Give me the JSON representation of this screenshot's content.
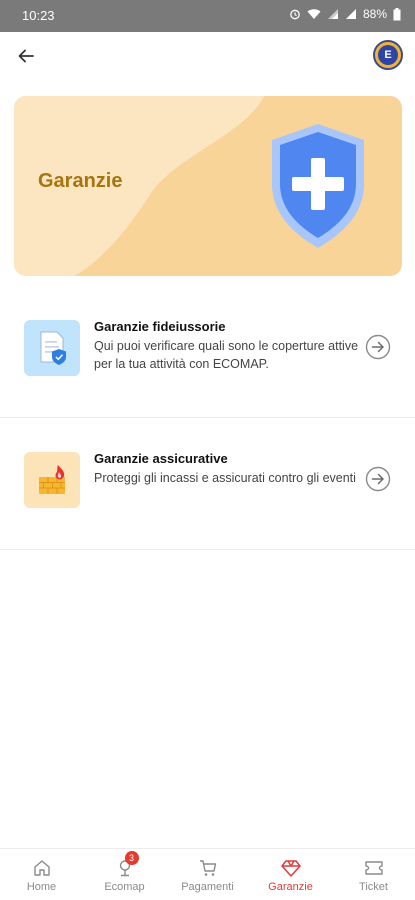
{
  "status_bar": {
    "time": "10:23",
    "battery": "88%",
    "icons": [
      "alarm-icon",
      "wifi-icon",
      "signal-icon",
      "signal-icon",
      "battery-icon"
    ]
  },
  "app_bar": {
    "back_icon": "arrow-left-icon",
    "avatar_letter": "E"
  },
  "hero": {
    "title": "Garanzie",
    "icon": "shield-plus-icon",
    "colors": {
      "background": "#f9d499",
      "title": "#a6750f",
      "shield": "#4f86f0"
    }
  },
  "items": [
    {
      "title": "Garanzie fideiussorie",
      "description": "Qui puoi verificare quali sono le coperture attive per la tua attività con ECOMAP.",
      "icon": "document-shield-icon"
    },
    {
      "title": "Garanzie assicurative",
      "description": "Proteggi gli incassi e assicurati contro gli eventi",
      "icon": "wall-fire-icon"
    }
  ],
  "bottom_nav": {
    "items": [
      {
        "label": "Home",
        "icon": "home-icon"
      },
      {
        "label": "Ecomap",
        "icon": "map-pin-icon",
        "badge": "3"
      },
      {
        "label": "Pagamenti",
        "icon": "cart-icon"
      },
      {
        "label": "Garanzie",
        "icon": "diamond-icon",
        "active": true
      },
      {
        "label": "Ticket",
        "icon": "ticket-icon"
      }
    ],
    "active_color": "#e03b3b"
  }
}
